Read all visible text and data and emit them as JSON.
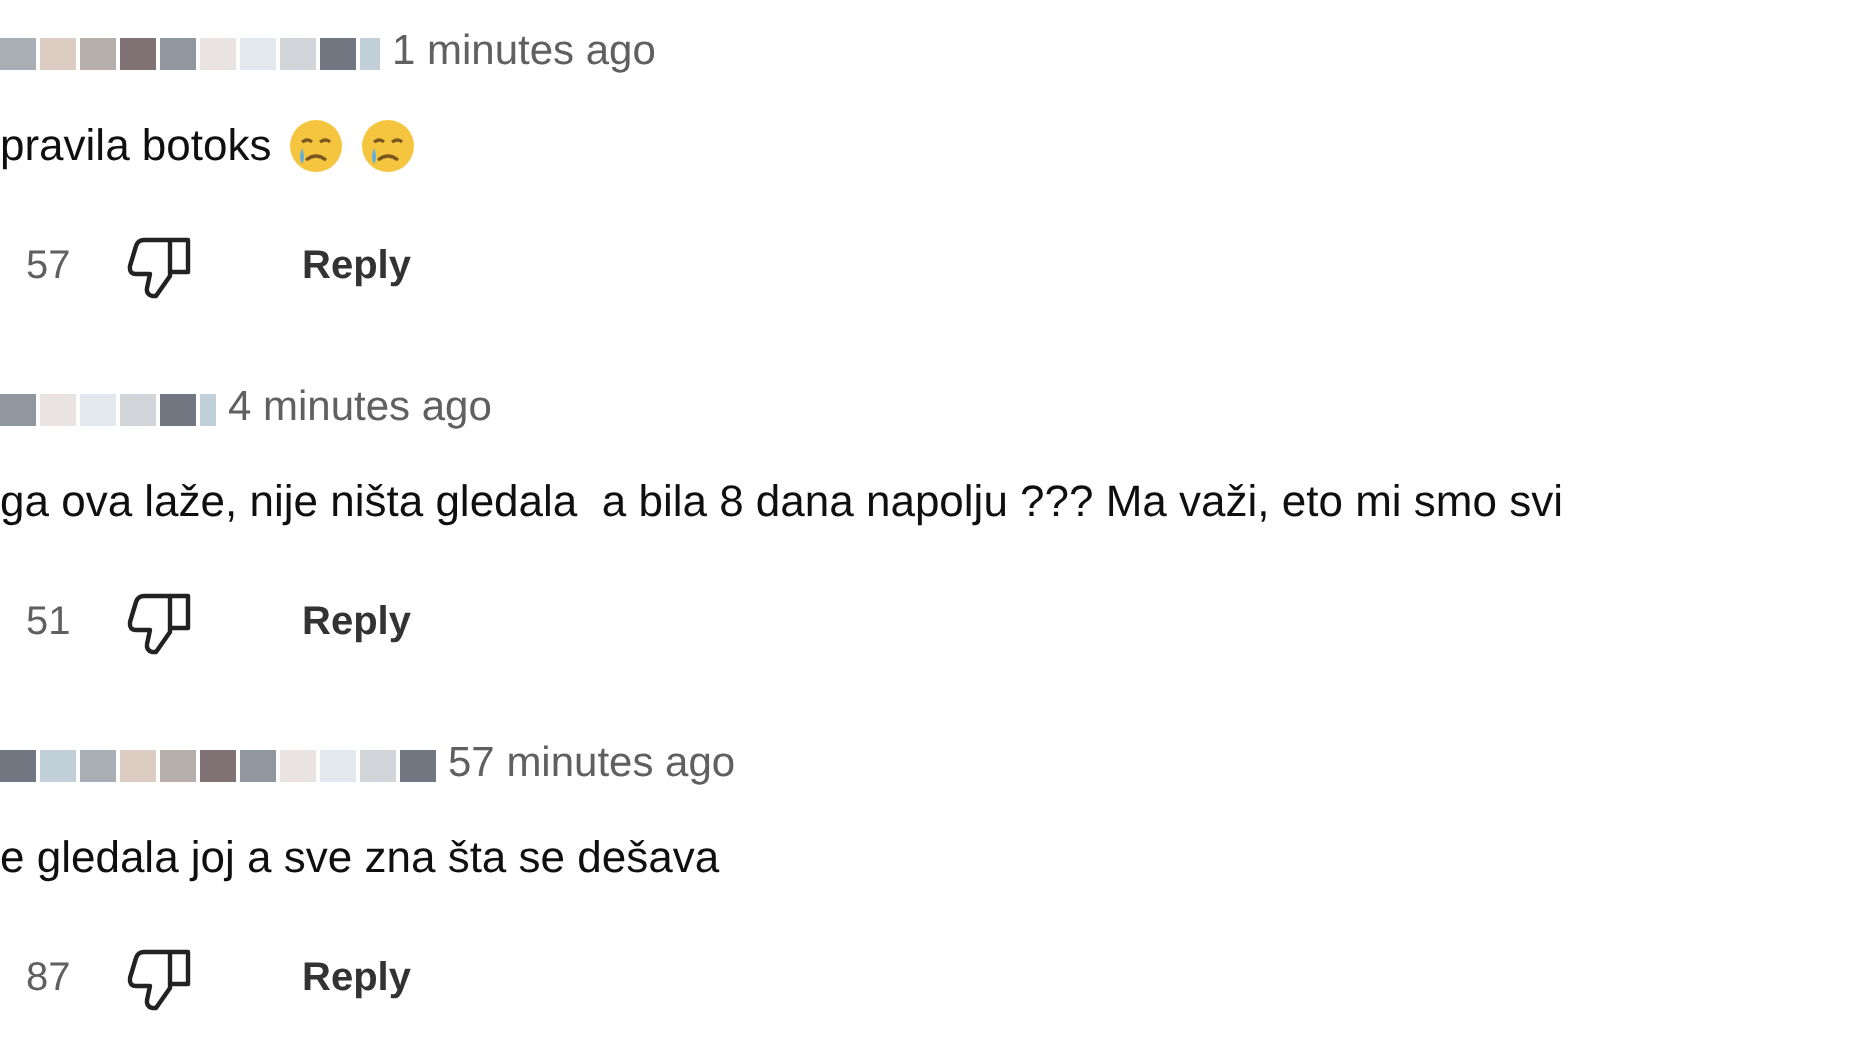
{
  "comments": [
    {
      "time": "1 minutes ago",
      "text": "pravila botoks",
      "emojis": [
        {
          "kind": "crying"
        },
        {
          "kind": "crying"
        }
      ],
      "likes": "57",
      "reply": "Reply"
    },
    {
      "time": "4 minutes ago",
      "text": "ga ova laže, nije ništa gledala  a bila 8 dana napolju ??? Ma važi, eto mi smo svi",
      "likes": "51",
      "reply": "Reply"
    },
    {
      "time": "57 minutes ago",
      "text": "e gledala joj a sve zna šta se dešava",
      "likes": "87",
      "reply": "Reply"
    }
  ]
}
